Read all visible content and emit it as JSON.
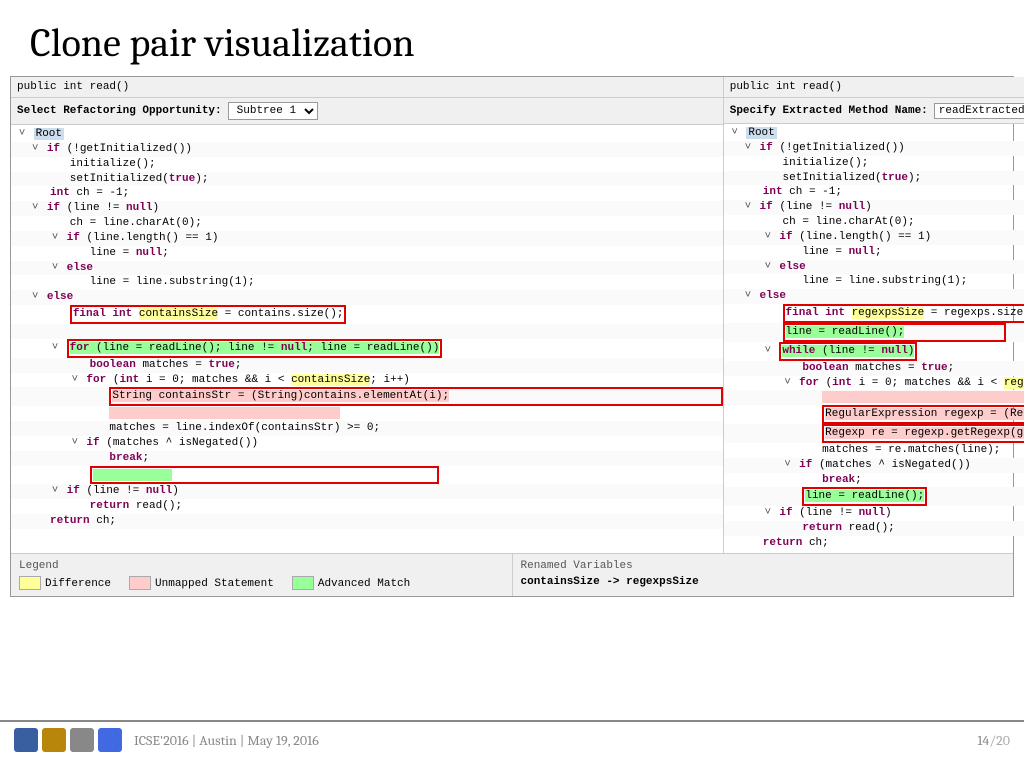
{
  "title": "Clone pair visualization",
  "left": {
    "signature": "public int read()",
    "control_label": "Select Refactoring Opportunity:",
    "dropdown_value": "Subtree 1",
    "root_label": "Root"
  },
  "right": {
    "signature": "public int read()",
    "control_label": "Specify Extracted Method Name:",
    "input_value": "readExtracted",
    "root_label": "Root"
  },
  "legend": {
    "title": "Legend",
    "difference": "Difference",
    "unmapped": "Unmapped Statement",
    "advanced": "Advanced Match"
  },
  "renamed": {
    "title": "Renamed Variables",
    "entry": "containsSize -> regexpsSize"
  },
  "footer": {
    "text": "ICSE'2016 | Austin | May 19, 2016",
    "page_current": "14",
    "page_total": "/20"
  }
}
